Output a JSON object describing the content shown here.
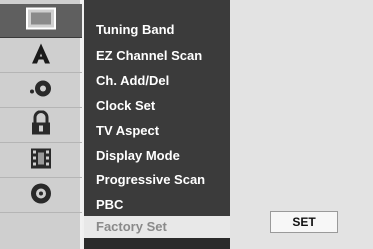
{
  "menu": {
    "items": [
      {
        "label": "Tuning Band"
      },
      {
        "label": "EZ Channel Scan"
      },
      {
        "label": "Ch. Add/Del"
      },
      {
        "label": "Clock Set"
      },
      {
        "label": "TV Aspect"
      },
      {
        "label": "Display Mode"
      },
      {
        "label": "Progressive Scan"
      },
      {
        "label": "PBC"
      },
      {
        "label": "Factory Set"
      }
    ],
    "selected_index": 8
  },
  "icons": [
    {
      "name": "general-setup-icon",
      "active": true
    },
    {
      "name": "language-icon",
      "active": false
    },
    {
      "name": "audio-icon",
      "active": false
    },
    {
      "name": "lock-icon",
      "active": false
    },
    {
      "name": "recording-icon",
      "active": false
    },
    {
      "name": "disc-icon",
      "active": false
    }
  ],
  "set_button": {
    "label": "SET"
  },
  "colors": {
    "menu_bg": "#3b3b3b",
    "active_tile": "#5f5f5f",
    "highlight": "#e8e8e8"
  }
}
